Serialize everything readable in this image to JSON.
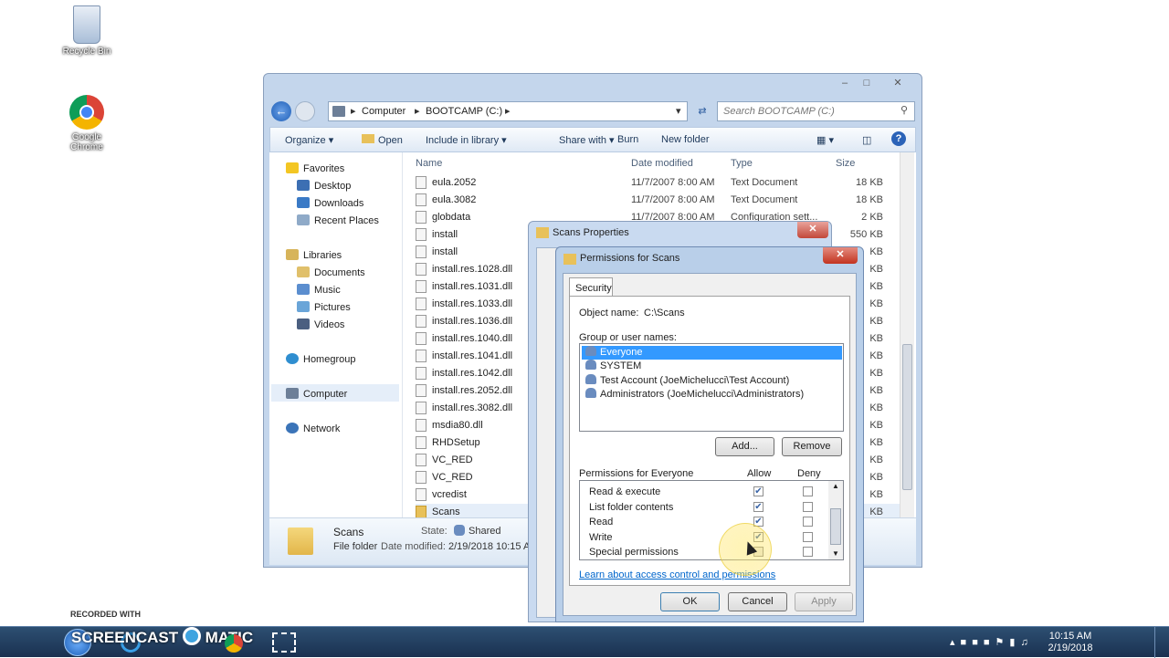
{
  "desktop": {
    "icons": [
      {
        "label": "Recycle Bin"
      },
      {
        "label": "Google Chrome"
      }
    ]
  },
  "explorer": {
    "breadcrumb": [
      "Computer",
      "BOOTCAMP (C:)"
    ],
    "search_placeholder": "Search BOOTCAMP (C:)",
    "toolbar": {
      "organize": "Organize",
      "open": "Open",
      "include": "Include in library",
      "share": "Share with",
      "burn": "Burn",
      "new_folder": "New folder"
    },
    "nav": {
      "favorites": "Favorites",
      "desktop": "Desktop",
      "downloads": "Downloads",
      "recent": "Recent Places",
      "libraries": "Libraries",
      "documents": "Documents",
      "music": "Music",
      "pictures": "Pictures",
      "videos": "Videos",
      "homegroup": "Homegroup",
      "computer": "Computer",
      "network": "Network"
    },
    "columns": {
      "name": "Name",
      "date": "Date modified",
      "type": "Type",
      "size": "Size"
    },
    "files": [
      {
        "name": "eula.2052",
        "date": "11/7/2007 8:00 AM",
        "type": "Text Document",
        "size": "18 KB"
      },
      {
        "name": "eula.3082",
        "date": "11/7/2007 8:00 AM",
        "type": "Text Document",
        "size": "18 KB"
      },
      {
        "name": "globdata",
        "date": "11/7/2007 8:00 AM",
        "type": "Configuration sett...",
        "size": "2 KB"
      },
      {
        "name": "install",
        "date": "",
        "type": "",
        "size": "550 KB"
      },
      {
        "name": "install",
        "date": "",
        "type": "",
        "size": "KB"
      },
      {
        "name": "install.res.1028.dll",
        "date": "",
        "type": "",
        "size": "KB"
      },
      {
        "name": "install.res.1031.dll",
        "date": "",
        "type": "",
        "size": "KB"
      },
      {
        "name": "install.res.1033.dll",
        "date": "",
        "type": "",
        "size": "KB"
      },
      {
        "name": "install.res.1036.dll",
        "date": "",
        "type": "",
        "size": "KB"
      },
      {
        "name": "install.res.1040.dll",
        "date": "",
        "type": "",
        "size": "KB"
      },
      {
        "name": "install.res.1041.dll",
        "date": "",
        "type": "",
        "size": "KB"
      },
      {
        "name": "install.res.1042.dll",
        "date": "",
        "type": "",
        "size": "KB"
      },
      {
        "name": "install.res.2052.dll",
        "date": "",
        "type": "",
        "size": "KB"
      },
      {
        "name": "install.res.3082.dll",
        "date": "",
        "type": "",
        "size": "KB"
      },
      {
        "name": "msdia80.dll",
        "date": "",
        "type": "",
        "size": "KB"
      },
      {
        "name": "RHDSetup",
        "date": "",
        "type": "",
        "size": "KB"
      },
      {
        "name": "VC_RED",
        "date": "",
        "type": "",
        "size": "KB"
      },
      {
        "name": "VC_RED",
        "date": "",
        "type": "",
        "size": "KB"
      },
      {
        "name": "vcredist",
        "date": "",
        "type": "",
        "size": "KB"
      },
      {
        "name": "Scans",
        "date": "",
        "type": "",
        "size": "KB"
      }
    ],
    "details": {
      "name": "Scans",
      "kind": "File folder",
      "state_label": "State:",
      "state": "Shared",
      "date_label": "Date modified:",
      "date": "2/19/2018 10:15 AM"
    }
  },
  "props": {
    "title": "Scans Properties"
  },
  "perm": {
    "title": "Permissions for Scans",
    "tab": "Security",
    "object_label": "Object name:",
    "object": "C:\\Scans",
    "group_label": "Group or user names:",
    "users": [
      "Everyone",
      "SYSTEM",
      "Test Account (JoeMichelucci\\Test Account)",
      "Administrators (JoeMichelucci\\Administrators)"
    ],
    "add": "Add...",
    "remove": "Remove",
    "perms_label": "Permissions for Everyone",
    "allow": "Allow",
    "deny": "Deny",
    "perms": [
      {
        "name": "Read & execute",
        "allow": true,
        "deny": false
      },
      {
        "name": "List folder contents",
        "allow": true,
        "deny": false
      },
      {
        "name": "Read",
        "allow": true,
        "deny": false
      },
      {
        "name": "Write",
        "allow": true,
        "deny": false
      },
      {
        "name": "Special permissions",
        "allow": false,
        "deny": false
      }
    ],
    "link": "Learn about access control and permissions",
    "ok": "OK",
    "cancel": "Cancel",
    "apply": "Apply"
  },
  "taskbar": {
    "time": "10:15 AM",
    "date": "2/19/2018"
  },
  "watermark": {
    "line1": "RECORDED WITH",
    "line2": "SCREENCAST",
    "line3": "MATIC"
  }
}
